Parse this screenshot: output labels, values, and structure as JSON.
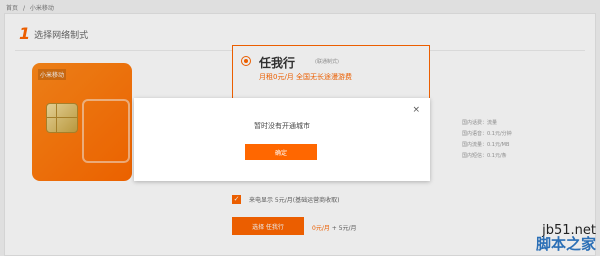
{
  "breadcrumb": {
    "home": "首页",
    "sep": "/",
    "current": "小米移动"
  },
  "step": {
    "number": "1",
    "title": "选择网络制式"
  },
  "sim": {
    "logo": "小米移动",
    "brand": "任"
  },
  "plan": {
    "name": "任我行",
    "tag": "(联通制式)",
    "desc": "月租0元/月 全国无长途漫游费"
  },
  "details": [
    "国内话费：流量",
    "国内语音：0.1元/分钟",
    "国内流量：0.1元/MB",
    "国内短信：0.1元/条"
  ],
  "option": {
    "label": "来电显示 5元/月(基础运营商收取)"
  },
  "buy": {
    "label": "选择 任我行"
  },
  "price": {
    "main": "0元/月",
    "sub": "+ 5元/月"
  },
  "modal": {
    "message": "暂时没有开通城市",
    "confirm": "确定",
    "close": "×"
  },
  "watermark": {
    "site": "jb51.net",
    "name": "脚本之家"
  }
}
